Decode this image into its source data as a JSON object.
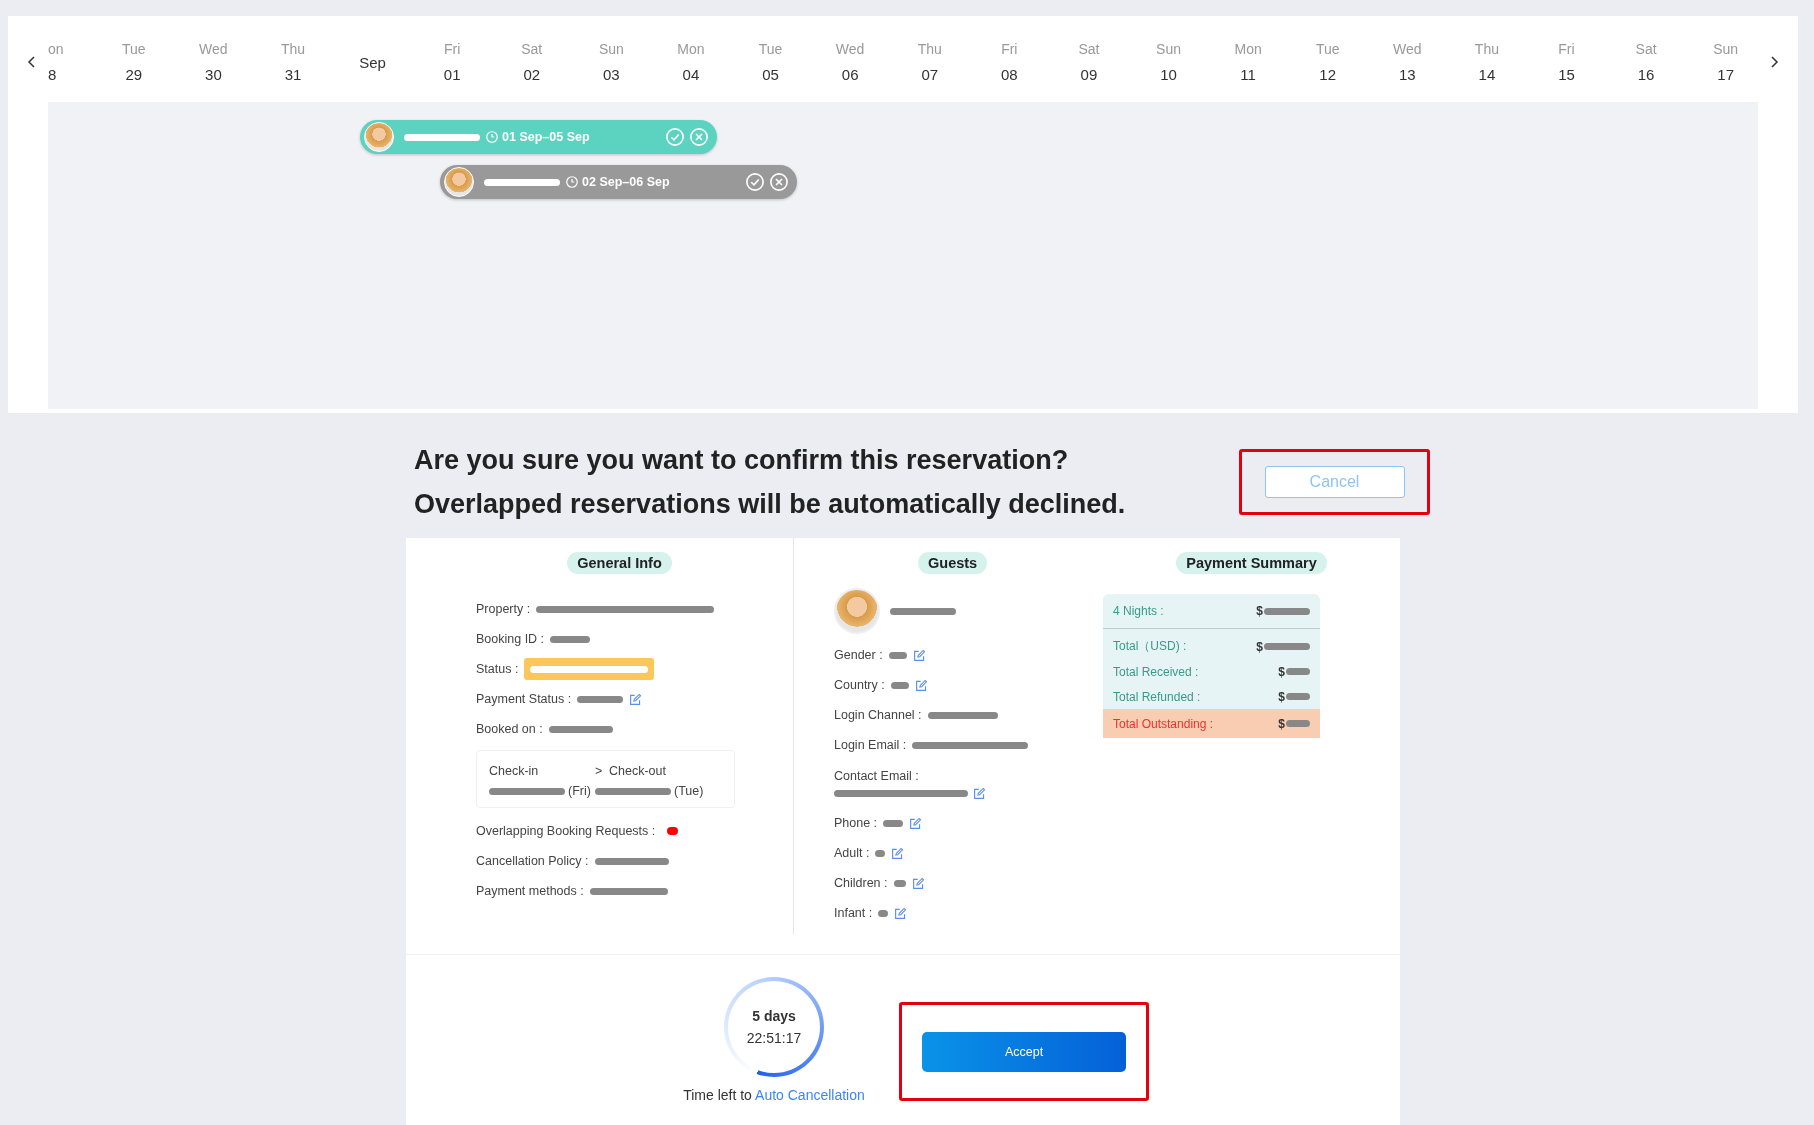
{
  "calendar": {
    "days": [
      {
        "kind": "day",
        "weekday": "on",
        "day": "8"
      },
      {
        "kind": "day",
        "weekday": "Tue",
        "day": "29"
      },
      {
        "kind": "day",
        "weekday": "Wed",
        "day": "30"
      },
      {
        "kind": "day",
        "weekday": "Thu",
        "day": "31"
      },
      {
        "kind": "month",
        "label": "Sep"
      },
      {
        "kind": "day",
        "weekday": "Fri",
        "day": "01"
      },
      {
        "kind": "day",
        "weekday": "Sat",
        "day": "02"
      },
      {
        "kind": "day",
        "weekday": "Sun",
        "day": "03"
      },
      {
        "kind": "day",
        "weekday": "Mon",
        "day": "04"
      },
      {
        "kind": "day",
        "weekday": "Tue",
        "day": "05"
      },
      {
        "kind": "day",
        "weekday": "Wed",
        "day": "06"
      },
      {
        "kind": "day",
        "weekday": "Thu",
        "day": "07"
      },
      {
        "kind": "day",
        "weekday": "Fri",
        "day": "08"
      },
      {
        "kind": "day",
        "weekday": "Sat",
        "day": "09"
      },
      {
        "kind": "day",
        "weekday": "Sun",
        "day": "10"
      },
      {
        "kind": "day",
        "weekday": "Mon",
        "day": "11"
      },
      {
        "kind": "day",
        "weekday": "Tue",
        "day": "12"
      },
      {
        "kind": "day",
        "weekday": "Wed",
        "day": "13"
      },
      {
        "kind": "day",
        "weekday": "Thu",
        "day": "14"
      },
      {
        "kind": "day",
        "weekday": "Fri",
        "day": "15"
      },
      {
        "kind": "day",
        "weekday": "Sat",
        "day": "16"
      },
      {
        "kind": "day",
        "weekday": "Sun",
        "day": "17"
      }
    ],
    "bookings": [
      {
        "dates": "01 Sep–05 Sep",
        "color": "#5cd3c0"
      },
      {
        "dates": "02 Sep–06 Sep",
        "color": "#999999"
      }
    ]
  },
  "prompt": {
    "lines": [
      "Are you sure you want to confirm this reservation?",
      "Overlapped reservations will be automatically declined."
    ],
    "cancel": "Cancel"
  },
  "general_info": {
    "title": "General Info",
    "fields": [
      {
        "kind": "redacted",
        "label": "Property :",
        "editable": false
      },
      {
        "kind": "redacted",
        "label": "Booking ID :",
        "editable": false
      },
      {
        "kind": "status",
        "label": "Status :",
        "editable": false
      },
      {
        "kind": "redacted",
        "label": "Payment Status :",
        "editable": true
      },
      {
        "kind": "redacted",
        "label": "Booked on :",
        "editable": false
      },
      {
        "kind": "stay",
        "checkin": "Check-in",
        "arrow": ">",
        "checkout": "Check-out",
        "checkin_day": "(Fri)",
        "checkout_day": "(Tue)"
      },
      {
        "kind": "dot",
        "label": "Overlapping Booking Requests :",
        "editable": false
      },
      {
        "kind": "redacted",
        "label": "Cancellation Policy :",
        "editable": false
      },
      {
        "kind": "redacted",
        "label": "Payment methods :",
        "editable": false
      }
    ]
  },
  "guests": {
    "title": "Guests",
    "fields": [
      {
        "kind": "redacted",
        "label": "Gender :",
        "editable": true
      },
      {
        "kind": "redacted",
        "label": "Country :",
        "editable": true
      },
      {
        "kind": "redacted",
        "label": "Login Channel :",
        "editable": false
      },
      {
        "kind": "redacted",
        "label": "Login Email :",
        "editable": false
      },
      {
        "kind": "wrapped",
        "label": "Contact Email :",
        "editable": true
      },
      {
        "kind": "redacted",
        "label": "Phone :",
        "editable": true
      },
      {
        "kind": "redacted",
        "label": "Adult :",
        "editable": true
      },
      {
        "kind": "redacted",
        "label": "Children :",
        "editable": true
      },
      {
        "kind": "redacted",
        "label": "Infant :",
        "editable": true
      }
    ]
  },
  "payment_summary": {
    "title": "Payment Summary",
    "rows": [
      {
        "kind": "normal",
        "label": "4 Nights :",
        "currency": "$"
      },
      {
        "kind": "normal",
        "label": "Total（USD) :",
        "currency": "$"
      },
      {
        "kind": "normal",
        "label": "Total Received :",
        "currency": "$"
      },
      {
        "kind": "normal",
        "label": "Total Refunded :",
        "currency": "$"
      },
      {
        "kind": "outstanding",
        "label": "Total Outstanding :",
        "currency": "$"
      }
    ]
  },
  "countdown": {
    "days": "5 days",
    "time": "22:51:17",
    "caption": "Time left to",
    "link": "Auto Cancellation"
  },
  "accept": "Accept"
}
